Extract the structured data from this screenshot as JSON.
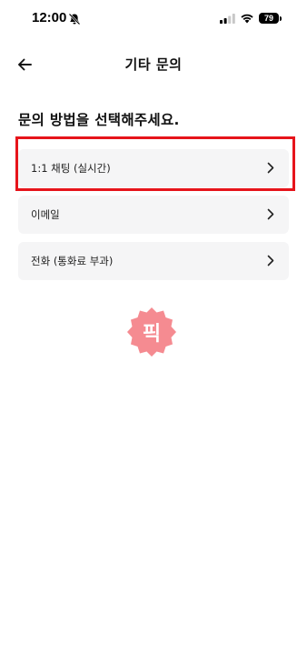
{
  "status_bar": {
    "time": "12:00",
    "battery": "79",
    "icons": [
      "bell-muted-icon",
      "signal-icon",
      "wifi-icon",
      "battery-icon"
    ]
  },
  "header": {
    "back_icon": "arrow-left-icon",
    "title": "기타 문의"
  },
  "main": {
    "heading": "문의 방법을 선택해주세요.",
    "options": [
      {
        "label": "1:1 채팅 (실시간)",
        "icon": "chevron-right-icon",
        "highlighted": true
      },
      {
        "label": "이메일",
        "icon": "chevron-right-icon",
        "highlighted": false
      },
      {
        "label": "전화 (통화료 부과)",
        "icon": "chevron-right-icon",
        "highlighted": false
      }
    ]
  },
  "watermark": {
    "text": "픽",
    "color": "#f47f86"
  },
  "colors": {
    "highlight": "#e6141b",
    "option_background": "#f5f5f6"
  }
}
